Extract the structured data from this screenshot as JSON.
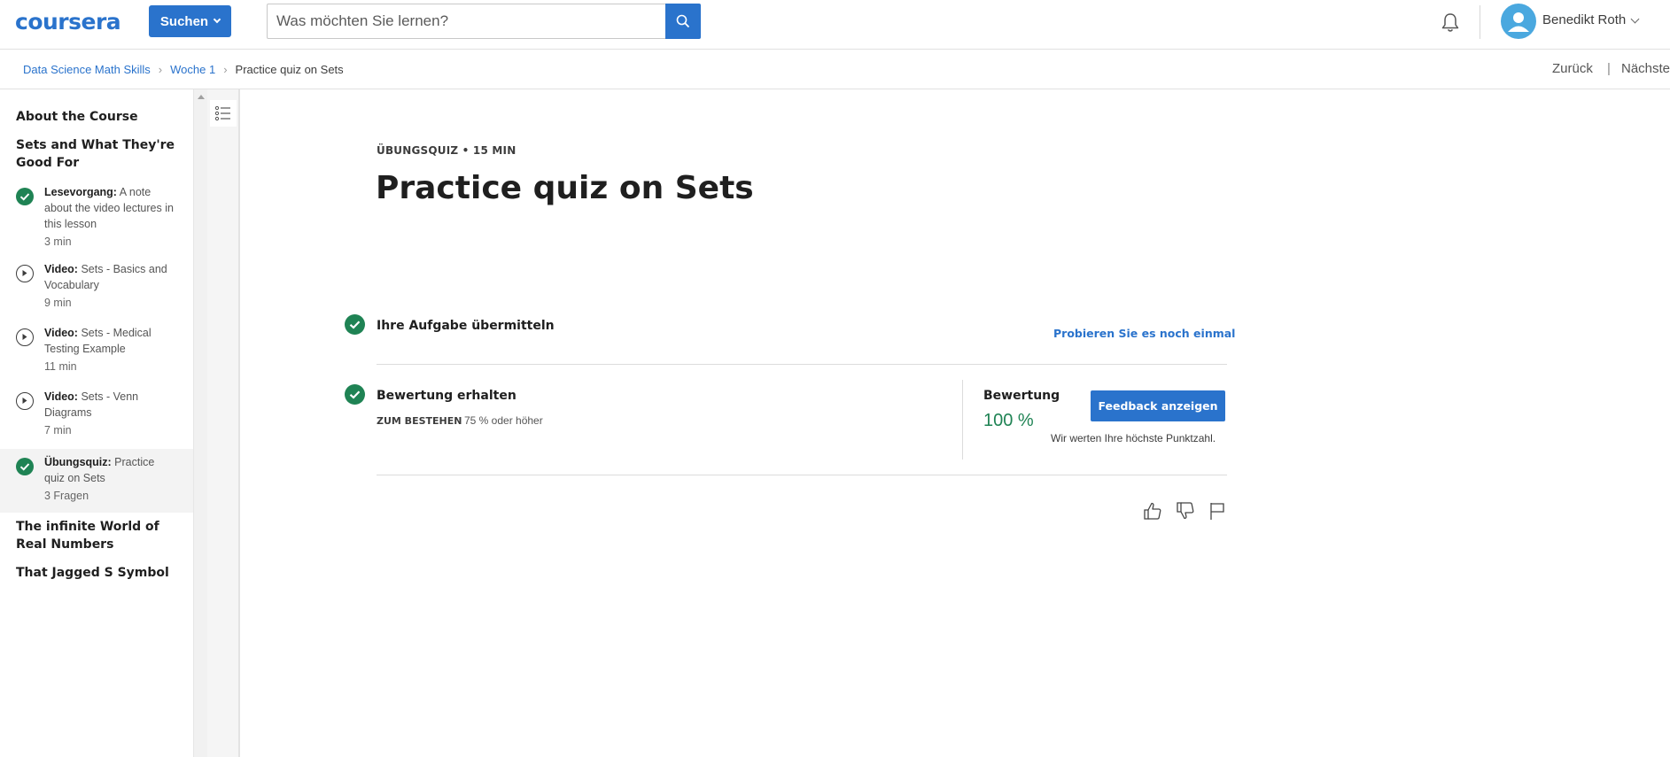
{
  "header": {
    "logo": "coursera",
    "search_button": "Suchen",
    "search_placeholder": "Was möchten Sie lernen?",
    "user_name": "Benedikt Roth",
    "brand_color": "#2a73cc"
  },
  "breadcrumb": {
    "items": [
      "Data Science Math Skills",
      "Woche 1",
      "Practice quiz on Sets"
    ],
    "back": "Zurück",
    "separator": "|",
    "next": "Nächstes"
  },
  "sidebar": {
    "sections": [
      "About the Course",
      "Sets and What They're Good For",
      "The infinite World of Real Numbers",
      "That Jagged S Symbol"
    ],
    "items": [
      {
        "type": "Lesevorgang:",
        "title": "A note about the video lectures in this lesson",
        "duration": "3 min",
        "icon": "check-icon"
      },
      {
        "type": "Video:",
        "title": "Sets - Basics and Vocabulary",
        "duration": "9 min",
        "icon": "play-icon"
      },
      {
        "type": "Video:",
        "title": "Sets - Medical Testing Example",
        "duration": "11 min",
        "icon": "play-icon"
      },
      {
        "type": "Video:",
        "title": "Sets - Venn Diagrams",
        "duration": "7 min",
        "icon": "play-icon"
      },
      {
        "type": "Übungsquiz:",
        "title": "Practice quiz on Sets",
        "duration": "3 Fragen",
        "icon": "check-icon"
      }
    ]
  },
  "main": {
    "eyebrow": "ÜBUNGSQUIZ • 15 MIN",
    "title": "Practice quiz on Sets",
    "step1": {
      "title": "Ihre Aufgabe übermitteln",
      "action": "Probieren Sie es noch einmal"
    },
    "step2": {
      "title": "Bewertung erhalten",
      "pass_label": "ZUM BESTEHEN",
      "pass_value": "75 % oder höher",
      "grade_label": "Bewertung",
      "grade_value": "100 %",
      "feedback_button": "Feedback anzeigen",
      "note": "Wir werten Ihre höchste Punktzahl."
    },
    "success_color": "#1f8354"
  }
}
